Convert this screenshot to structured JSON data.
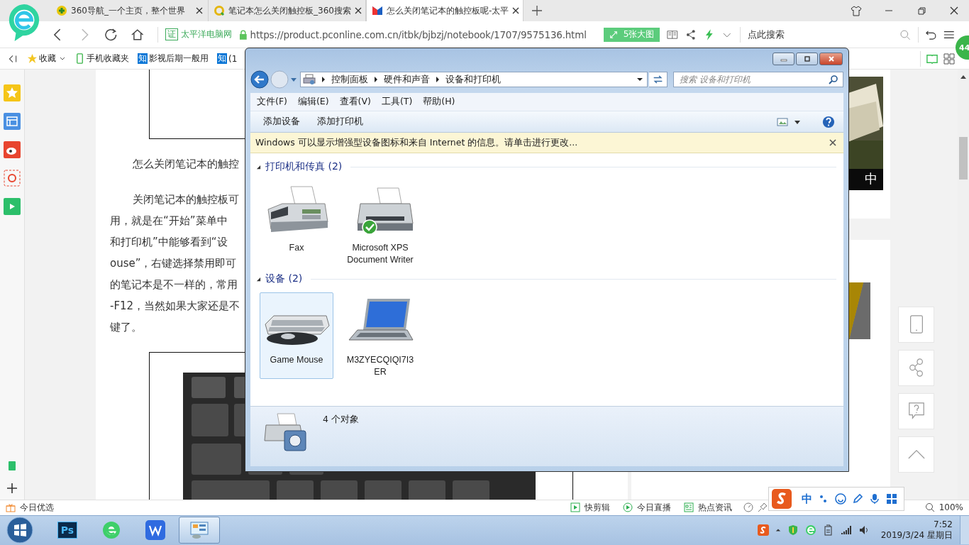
{
  "browser": {
    "tabs": [
      {
        "kind": "nav",
        "title": "360导航_一个主页，整个世界",
        "selected": false
      },
      {
        "kind": "search",
        "title": "笔记本怎么关闭触控板_360搜索",
        "selected": false
      },
      {
        "kind": "site",
        "title": "怎么关闭笔记本的触控板呢-太平",
        "selected": true
      }
    ],
    "site_badge": "证",
    "site_name": "太平洋电脑网",
    "url": "https://product.pconline.com.cn/itbk/bjbzj/notebook/1707/9575136.html",
    "gallery_button": "5张大图",
    "search_placeholder": "点此搜索",
    "bookmarks": [
      {
        "kind": "favorites",
        "label": "收藏"
      },
      {
        "kind": "phone",
        "label": "手机收藏夹"
      },
      {
        "kind": "zhi",
        "badge": "知",
        "label": "影视后期一般用"
      },
      {
        "kind": "zhi",
        "badge": "知",
        "label": "(1"
      }
    ],
    "notification_count": "44"
  },
  "article": {
    "paragraphs": [
      {
        "lines": [
          "怎么关闭笔记本的触控"
        ]
      },
      {
        "lines": [
          "关闭笔记本的触控板可",
          "用，就是在“开始”菜单中",
          "和打印机”中能够看到“设",
          "ouse”，右键选择禁用即可",
          "的笔记本是不一样的，常用",
          "-F12，当然如果大家还是不",
          "键了。"
        ]
      }
    ]
  },
  "ad_caption": "中",
  "dialog": {
    "breadcrumb": [
      "控制面板",
      "硬件和声音",
      "设备和打印机"
    ],
    "search_placeholder": "搜索 设备和打印机",
    "menu": [
      "文件(F)",
      "编辑(E)",
      "查看(V)",
      "工具(T)",
      "帮助(H)"
    ],
    "toolbar": [
      "添加设备",
      "添加打印机"
    ],
    "info": "Windows 可以显示增强型设备图标和来自 Internet 的信息。请单击进行更改...",
    "groups": [
      {
        "title": "打印机和传真 (2)",
        "items": [
          {
            "kind": "fax",
            "name": "Fax",
            "default": false,
            "selected": false
          },
          {
            "kind": "printer",
            "name": "Microsoft XPS Document Writer",
            "default": true,
            "selected": false
          }
        ]
      },
      {
        "title": "设备 (2)",
        "items": [
          {
            "kind": "keyboard",
            "name": "Game Mouse",
            "default": false,
            "selected": true
          },
          {
            "kind": "laptop",
            "name": "M3ZYECQIQI7I3ER",
            "default": false,
            "selected": false
          }
        ]
      }
    ],
    "details": "4 个对象"
  },
  "status_bar": {
    "left": "今日优选",
    "items": [
      {
        "kind": "clip",
        "label": "快剪辑"
      },
      {
        "kind": "live",
        "label": "今日直播"
      },
      {
        "kind": "news",
        "label": "热点资讯"
      }
    ],
    "zoom": "100%"
  },
  "ime": {
    "mode": "中"
  },
  "taskbar": {
    "apps": [
      {
        "kind": "ps",
        "badge": "Ps",
        "selected": false
      },
      {
        "kind": "browser",
        "selected": false
      },
      {
        "kind": "wps",
        "selected": false
      },
      {
        "kind": "control-panel",
        "selected": true
      }
    ],
    "time": "7:52",
    "date": "2019/3/24 星期日"
  }
}
